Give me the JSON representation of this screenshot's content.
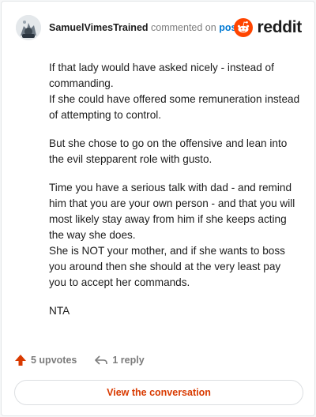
{
  "header": {
    "author": "SamuelVimesTrained",
    "commented_text": "commented on",
    "post_link": "post",
    "brand_name": "reddit",
    "brand_color": "#ff4500"
  },
  "comment": {
    "paragraphs": [
      [
        "If that lady would have asked nicely - instead of commanding.",
        "If she could have offered some remuneration instead of attempting to control."
      ],
      [
        "But she chose to go on the offensive and lean into the evil stepparent role with gusto."
      ],
      [
        "Time you have a serious talk with dad - and remind him that you are your own person - and that you will most likely stay away from him if she keeps acting the way she does.",
        "She is NOT your mother, and if she wants to boss you around then she should at the very least pay you to accept her commands."
      ],
      [
        "NTA"
      ]
    ]
  },
  "actions": {
    "upvotes_label": "5 upvotes",
    "reply_label": "1 reply",
    "upvote_icon": "upvote-arrow-icon",
    "reply_icon": "reply-arrow-icon",
    "upvote_color": "#d93a00"
  },
  "footer": {
    "view_label": "View the conversation"
  }
}
